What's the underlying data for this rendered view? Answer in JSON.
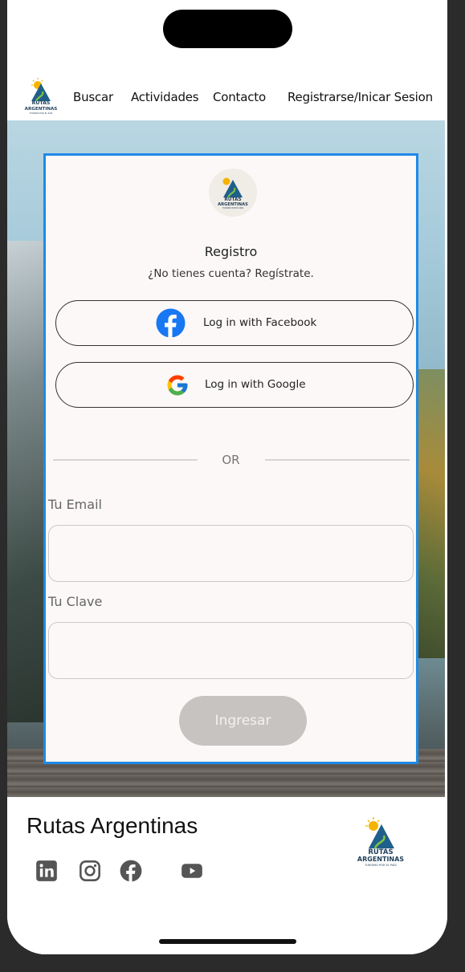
{
  "nav": {
    "items": [
      "Buscar",
      "Actividades",
      "Contacto",
      "Registrarse/Inicar Sesion"
    ],
    "logo_line1": "RUTAS",
    "logo_line2": "ARGENTINAS",
    "logo_tagline": "TURISMO POR EL PAÍS"
  },
  "card": {
    "logo_line1": "RUTAS",
    "logo_line2": "ARGENTINAS",
    "logo_tagline": "TURISMO POR EL PAÍS",
    "title": "Registro",
    "subtitle": "¿No tienes cuenta? Regístrate.",
    "facebook_label": "Log in with Facebook",
    "google_label": "Log in with Google",
    "or_text": "OR",
    "email_label": "Tu Email",
    "email_value": "",
    "password_label": "Tu Clave",
    "password_value": "",
    "submit_label": "Ingresar"
  },
  "footer": {
    "title": "Rutas Argentinas",
    "social_icons": [
      "linkedin-icon",
      "instagram-icon",
      "facebook-icon",
      "youtube-icon"
    ],
    "logo_line1": "RUTAS",
    "logo_line2": "ARGENTINAS",
    "logo_tagline": "TURISMO POR EL PAÍS"
  },
  "colors": {
    "accent_border": "#1f8ae6",
    "facebook_blue": "#1877f2",
    "submit_disabled": "#c6c3c1",
    "logo_blue": "#1f5f8b"
  }
}
